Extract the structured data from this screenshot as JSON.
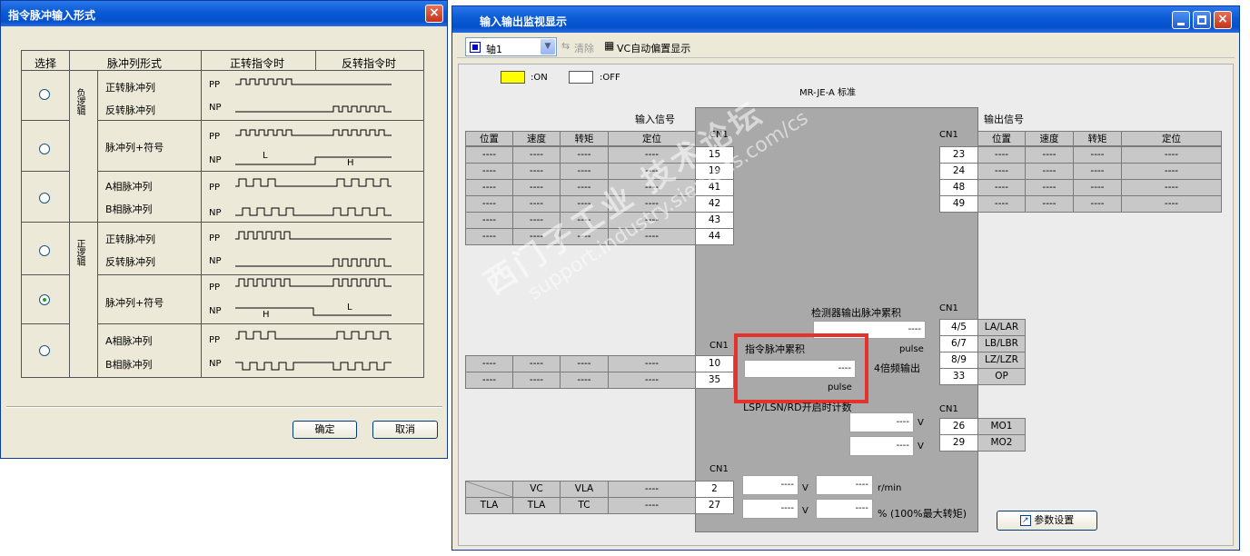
{
  "left_dialog": {
    "title": "指令脉冲输入形式",
    "headers": {
      "select": "选择",
      "form": "脉冲列形式",
      "fwd": "正转指令时",
      "rev": "反转指令时"
    },
    "groups": {
      "neg": "负逻辑",
      "pos": "正逻辑"
    },
    "rows": [
      {
        "l1": "正转脉冲列",
        "l2": "反转脉冲列",
        "s1": "PP",
        "s2": "NP",
        "selected": false
      },
      {
        "l1": "脉冲列+符号",
        "l2": "",
        "s1": "PP",
        "s2": "NP",
        "h1": "L",
        "h2": "H",
        "selected": false
      },
      {
        "l1": "A相脉冲列",
        "l2": "B相脉冲列",
        "s1": "PP",
        "s2": "NP",
        "selected": false
      },
      {
        "l1": "正转脉冲列",
        "l2": "反转脉冲列",
        "s1": "PP",
        "s2": "NP",
        "selected": false
      },
      {
        "l1": "脉冲列+符号",
        "l2": "",
        "s1": "PP",
        "s2": "NP",
        "h1": "H",
        "h2": "L",
        "selected": true
      },
      {
        "l1": "A相脉冲列",
        "l2": "B相脉冲列",
        "s1": "PP",
        "s2": "NP",
        "selected": false
      }
    ],
    "ok_label": "确定",
    "cancel_label": "取消"
  },
  "right_window": {
    "title": "输入输出监视显示",
    "toolbar": {
      "axis": "轴1",
      "clear": "清除",
      "vc": "VC自动偏置显示"
    },
    "legend": {
      "on": ":ON",
      "off": ":OFF"
    },
    "model": "MR-JE-A 标准",
    "input_title": "输入信号",
    "output_title": "输出信号",
    "cols": [
      "位置",
      "速度",
      "转矩",
      "定位"
    ],
    "cn1": "CN1",
    "dash": "----",
    "input_pins": [
      "15",
      "19",
      "41",
      "42",
      "43",
      "44"
    ],
    "input_pins2": [
      "10",
      "35"
    ],
    "output_pins": [
      "23",
      "24",
      "48",
      "49"
    ],
    "enc_title": "检测器输出脉冲累积",
    "pulse": "pulse",
    "cmd_title": "指令脉冲累积",
    "x4": "4倍频输出",
    "enc_pins": [
      [
        "4/5",
        "LA/LAR"
      ],
      [
        "6/7",
        "LB/LBR"
      ],
      [
        "8/9",
        "LZ/LZR"
      ],
      [
        "33",
        "OP"
      ]
    ],
    "lsp": "LSP/LSN/RD开启时计数",
    "v": "V",
    "mo_pins": [
      [
        "26",
        "MO1"
      ],
      [
        "29",
        "MO2"
      ]
    ],
    "analog": [
      [
        "",
        "VC",
        "VLA",
        "----",
        "2"
      ],
      [
        "TLA",
        "TLA",
        "TC",
        "----",
        "27"
      ]
    ],
    "rmin": "r/min",
    "torque": "% (100%最大转矩)",
    "param": "参数设置",
    "watermark1": "西门子工业 技术论坛",
    "watermark2": "support.industry.siemens.com/cs"
  },
  "colors": {
    "title": "#0a5ad6",
    "on": "#ffff00",
    "highlight": "#e5322b"
  }
}
